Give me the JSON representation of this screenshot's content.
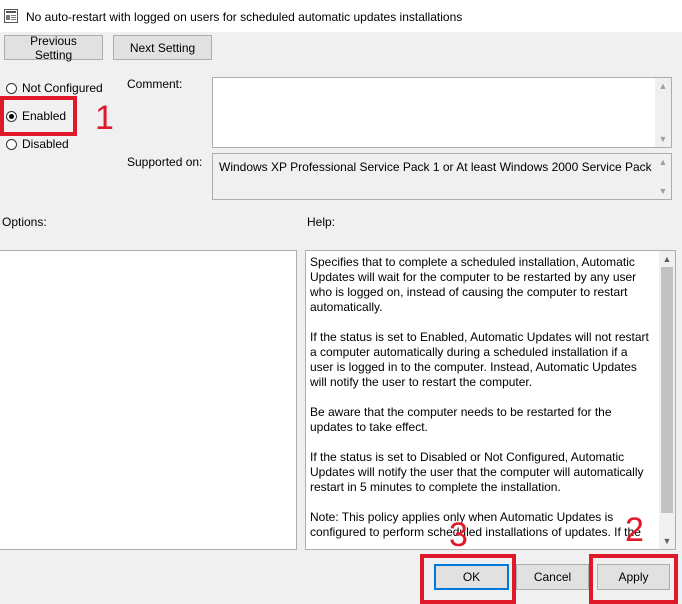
{
  "window": {
    "title": "No auto-restart with logged on users for scheduled automatic updates installations"
  },
  "nav": {
    "previous_label": "Previous Setting",
    "next_label": "Next Setting"
  },
  "state": {
    "options": [
      {
        "label": "Not Configured",
        "checked": false
      },
      {
        "label": "Enabled",
        "checked": true
      },
      {
        "label": "Disabled",
        "checked": false
      }
    ]
  },
  "comment": {
    "label": "Comment:",
    "value": ""
  },
  "supported": {
    "label": "Supported on:",
    "value": "Windows XP Professional Service Pack 1 or At least Windows 2000 Service Pack 3"
  },
  "options_pane": {
    "label": "Options:"
  },
  "help": {
    "label": "Help:",
    "paragraphs": [
      "Specifies that to complete a scheduled installation, Automatic Updates will wait for the computer to be restarted by any user who is logged on, instead of causing the computer to restart automatically.",
      "If the status is set to Enabled, Automatic Updates will not restart a computer automatically during a scheduled installation if a user is logged in to the computer. Instead, Automatic Updates will notify the user to restart the computer.",
      "Be aware that the computer needs to be restarted for the updates to take effect.",
      "If the status is set to Disabled or Not Configured, Automatic Updates will notify the user that the computer will automatically restart in 5 minutes to complete the installation.",
      "Note: This policy applies only when Automatic Updates is configured to perform scheduled installations of updates. If the"
    ]
  },
  "footer": {
    "ok_label": "OK",
    "cancel_label": "Cancel",
    "apply_label": "Apply"
  },
  "annotations": {
    "step1": "1",
    "step2": "2",
    "step3": "3",
    "color": "#e0192a"
  },
  "icons": [
    "policy-setting-icon",
    "scroll-up-icon",
    "scroll-down-icon"
  ]
}
